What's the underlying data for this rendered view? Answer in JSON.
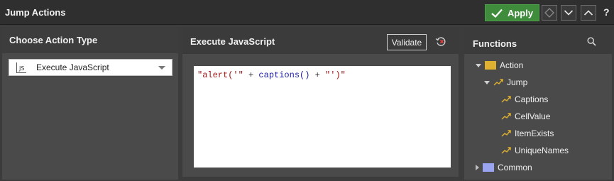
{
  "window": {
    "title": "Jump Actions"
  },
  "toolbar": {
    "apply_label": "Apply",
    "help_label": "?",
    "apply_color": "#3f8c3c",
    "icons": [
      "diamond-icon",
      "chevron-down-icon",
      "chevron-up-icon"
    ]
  },
  "left_panel": {
    "title": "Choose Action Type",
    "select": {
      "icon": "js-icon",
      "value": "Execute JavaScript"
    }
  },
  "middle_panel": {
    "title": "Execute JavaScript",
    "validate_label": "Validate",
    "code": {
      "part1": "\"alert('\"",
      "part2": " + ",
      "part3": "captions()",
      "part4": " + ",
      "part5": "\"')\""
    }
  },
  "right_panel": {
    "title": "Functions",
    "tree": {
      "action": "Action",
      "jump": "Jump",
      "captions": "Captions",
      "cellvalue": "CellValue",
      "itemexists": "ItemExists",
      "uniquenames": "UniqueNames",
      "common": "Common"
    }
  }
}
